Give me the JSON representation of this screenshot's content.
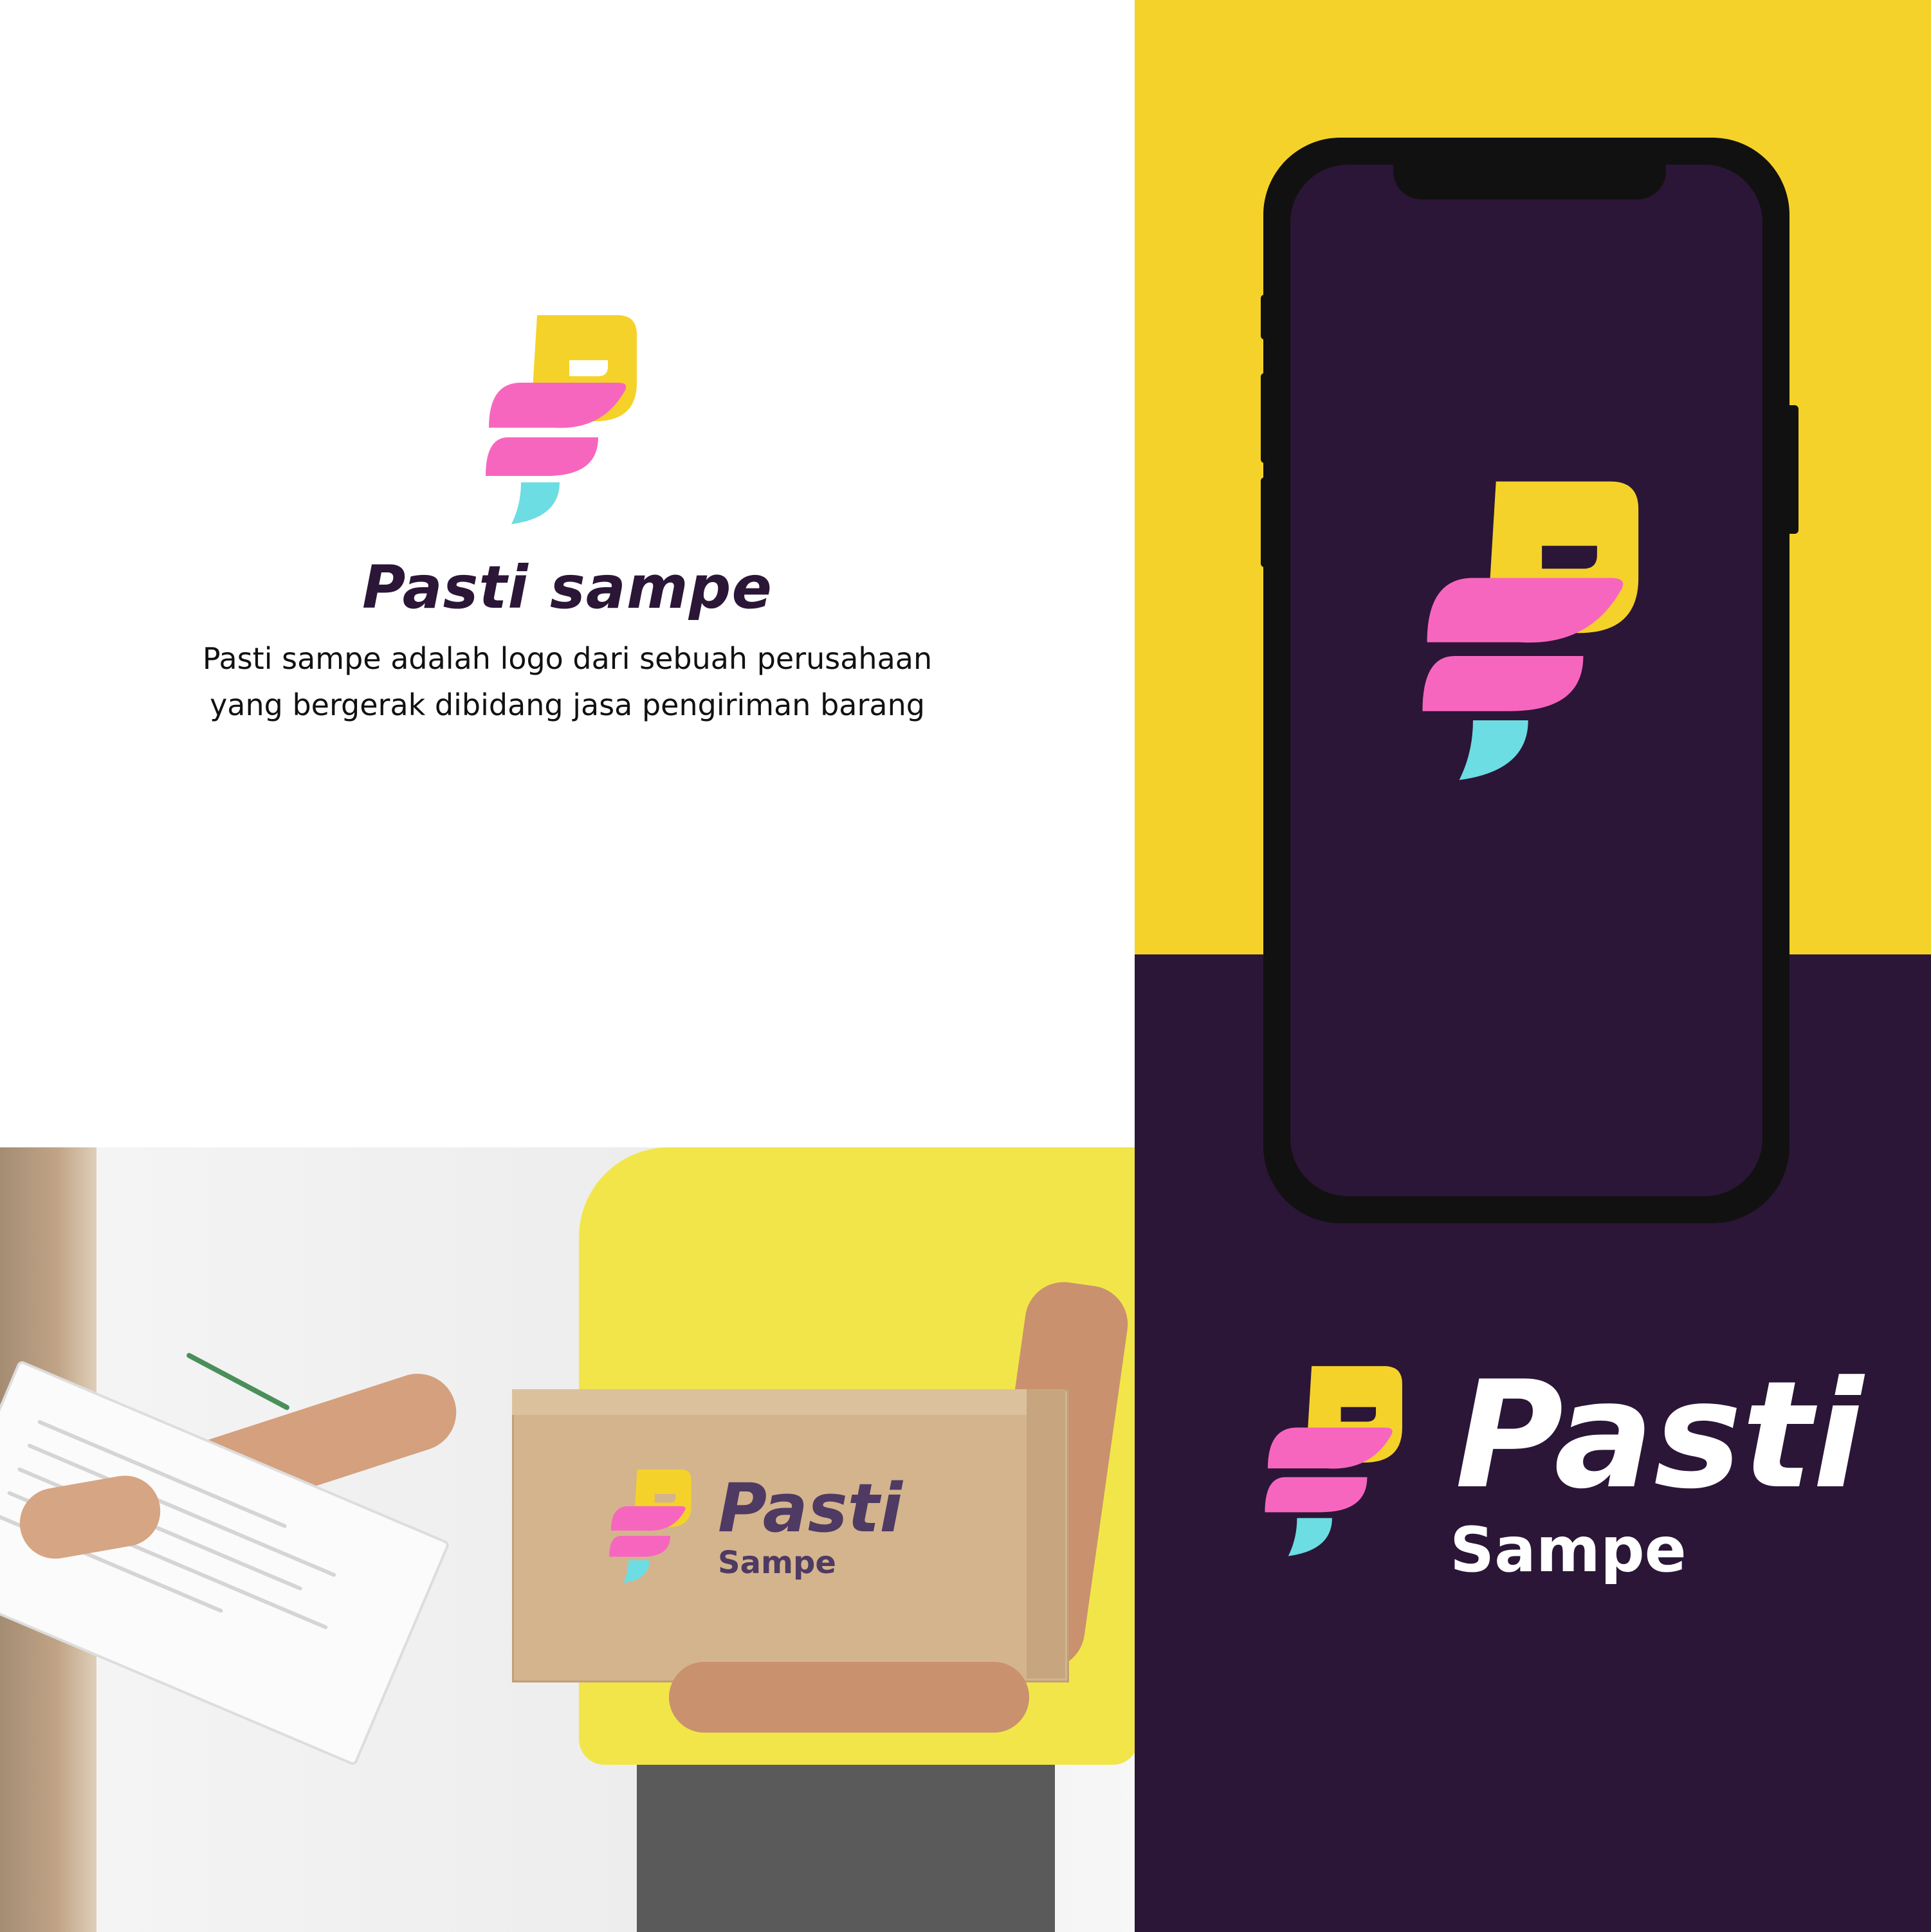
{
  "brand": {
    "title": "Pasti sampe",
    "description_line1": "Pasti sampe adalah logo dari sebuah perusahaan",
    "description_line2": "yang bergerak dibidang jasa pengiriman barang",
    "lockup_top": "Pasti",
    "lockup_bottom": "Sampe"
  },
  "colors": {
    "yellow": "#f5d22a",
    "purple": "#2b1637",
    "pink": "#f766be",
    "cyan": "#6cdde2",
    "phone_frame": "#111111",
    "box_text": "#4e3a62"
  },
  "icons": {
    "logo": "p-letter-logo-icon",
    "phone": "smartphone-mockup",
    "box": "cardboard-box"
  }
}
